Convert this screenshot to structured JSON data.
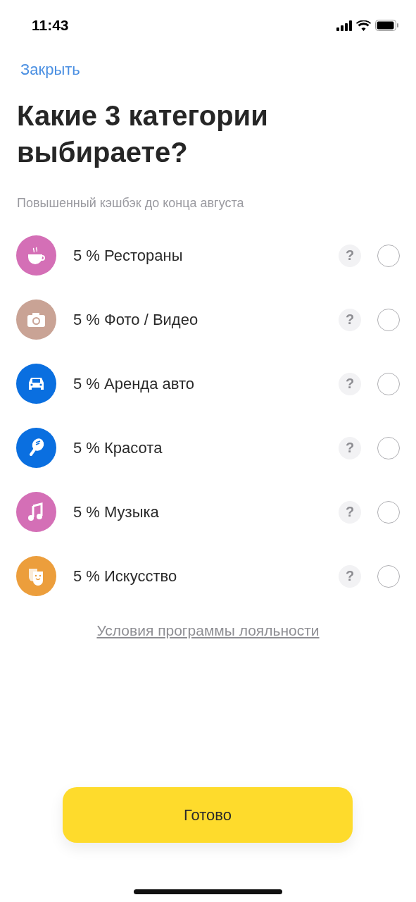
{
  "status_bar": {
    "time": "11:43"
  },
  "close": "Закрыть",
  "title": "Какие 3 категории выбираете?",
  "subtitle": "Повышенный кэшбэк до конца августа",
  "categories": [
    {
      "kind": "cup",
      "color": "#d46fb6",
      "label": "5 % Рестораны",
      "help": "?",
      "selected": false
    },
    {
      "kind": "camera",
      "color": "#c9a395",
      "label": "5 % Фото / Видео",
      "help": "?",
      "selected": false
    },
    {
      "kind": "car",
      "color": "#0a6fe0",
      "label": "5 % Аренда авто",
      "help": "?",
      "selected": false
    },
    {
      "kind": "mirror",
      "color": "#0a6fe0",
      "label": "5 % Красота",
      "help": "?",
      "selected": false
    },
    {
      "kind": "note",
      "color": "#d46fb6",
      "label": "5 % Музыка",
      "help": "?",
      "selected": false
    },
    {
      "kind": "masks",
      "color": "#ec9e3c",
      "label": "5 % Искусство",
      "help": "?",
      "selected": false
    }
  ],
  "terms_link": "Условия программы лояльности",
  "done_button": "Готово"
}
